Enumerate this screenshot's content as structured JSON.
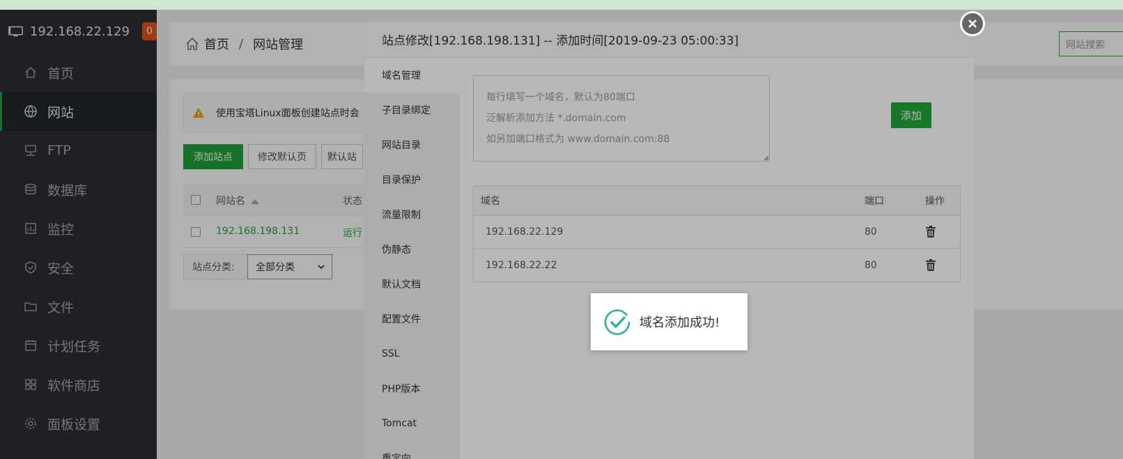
{
  "sidebar": {
    "server_ip": "192.168.22.129",
    "badge": "0",
    "items": [
      {
        "label": "首页",
        "icon": "home-icon"
      },
      {
        "label": "网站",
        "icon": "globe-icon",
        "active": true
      },
      {
        "label": "FTP",
        "icon": "ftp-icon"
      },
      {
        "label": "数据库",
        "icon": "database-icon"
      },
      {
        "label": "监控",
        "icon": "monitor-chart-icon"
      },
      {
        "label": "安全",
        "icon": "shield-icon"
      },
      {
        "label": "文件",
        "icon": "folder-icon"
      },
      {
        "label": "计划任务",
        "icon": "calendar-icon"
      },
      {
        "label": "软件商店",
        "icon": "apps-grid-icon"
      },
      {
        "label": "面板设置",
        "icon": "gear-icon"
      }
    ]
  },
  "header": {
    "crumb_home": "首页",
    "crumb_sep": "/",
    "crumb_current": "网站管理",
    "search_placeholder": "网站搜索"
  },
  "site_panel": {
    "alert_text": "使用宝塔Linux面板创建站点时会",
    "buttons": {
      "add_site": "添加站点",
      "edit_default": "修改默认页",
      "default_site": "默认站"
    },
    "table": {
      "col_name": "网站名",
      "col_status": "状态",
      "rows": [
        {
          "name": "192.168.198.131",
          "status": "运行"
        }
      ]
    },
    "category_label": "站点分类:",
    "category_value": "全部分类"
  },
  "modal": {
    "title": "站点修改[192.168.198.131] -- 添加时间[2019-09-23 05:00:33]",
    "tabs": [
      "域名管理",
      "子目录绑定",
      "网站目录",
      "目录保护",
      "流量限制",
      "伪静态",
      "默认文档",
      "配置文件",
      "SSL",
      "PHP版本",
      "Tomcat",
      "重定向"
    ],
    "textarea_placeholder": "每行填写一个域名，默认为80端口\n泛解析添加方法 *.domain.com\n如另加端口格式为 www.domain.com:88",
    "add_button": "添加",
    "domain_table": {
      "headers": {
        "domain": "域名",
        "port": "端口",
        "action": "操作"
      },
      "rows": [
        {
          "domain": "192.168.22.129",
          "port": "80"
        },
        {
          "domain": "192.168.22.22",
          "port": "80"
        }
      ]
    }
  },
  "toast": {
    "message": "域名添加成功!"
  },
  "colors": {
    "accent": "#20a53a",
    "sidebar_bg": "#2b2f33",
    "badge": "#e2531f",
    "success_icon": "#1fb19e"
  }
}
